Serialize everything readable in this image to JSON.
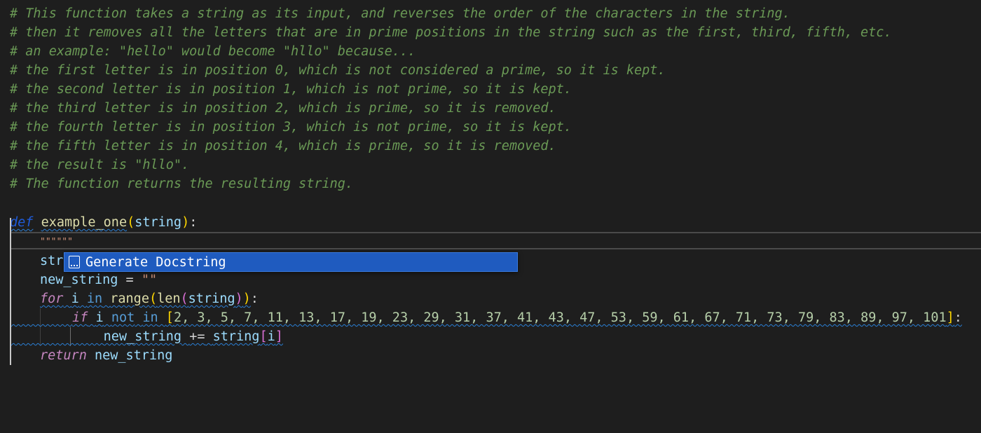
{
  "comments": [
    "# This function takes a string as its input, and reverses the order of the characters in the string.",
    "# then it removes all the letters that are in prime positions in the string such as the first, third, fifth, etc.",
    "# an example: \"hello\" would become \"hllo\" because...",
    "# the first letter is in position 0, which is not considered a prime, so it is kept.",
    "# the second letter is in position 1, which is not prime, so it is kept.",
    "# the third letter is in position 2, which is prime, so it is removed.",
    "# the fourth letter is in position 3, which is not prime, so it is kept.",
    "# the fifth letter is in position 4, which is prime, so it is removed.",
    "# the result is \"hllo\".",
    "# The function returns the resulting string."
  ],
  "code": {
    "def_kw": "def",
    "func_name": "example_one",
    "param": "string",
    "docstring": "\"\"\"\"\"\"",
    "line_str_prefix": "str",
    "new_string_init": "new_string",
    "empty_str": "\"\"",
    "for_kw": "for",
    "loop_var": "i",
    "in_kw": "in",
    "range_fn": "range",
    "len_fn": "len",
    "if_kw": "if",
    "not_kw": "not",
    "primes": "2, 3, 5, 7, 11, 13, 17, 19, 23, 29, 31, 37, 41, 43, 47, 53, 59, 61, 67, 71, 73, 79, 83, 89, 97, 101",
    "append_target": "new_string",
    "append_op": "+=",
    "return_kw": "return",
    "return_value": "new_string"
  },
  "suggestion": {
    "label": "Generate Docstring",
    "icon": "snippet-icon"
  },
  "colors": {
    "background": "#1e1e1e",
    "comment": "#6a9955",
    "suggest_bg": "#1f5bbf"
  }
}
